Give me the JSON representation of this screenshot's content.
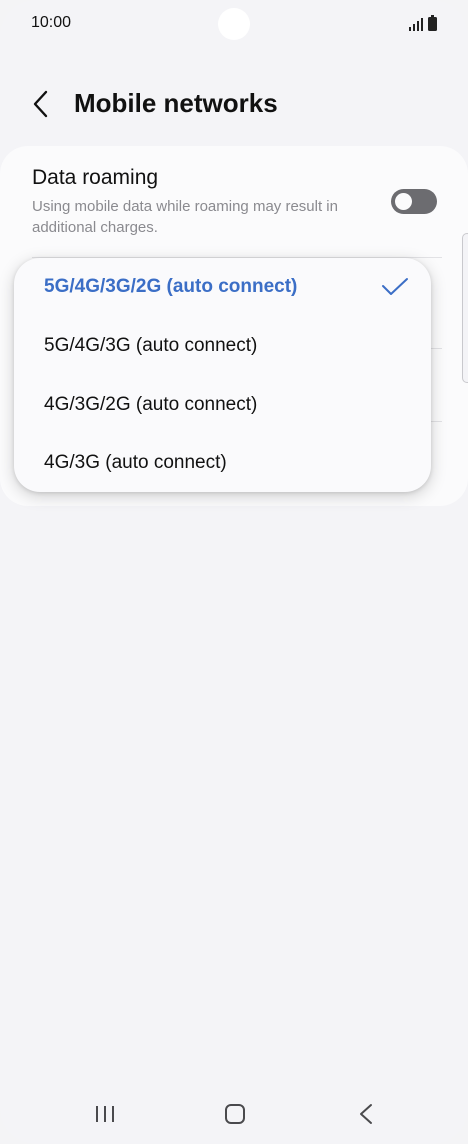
{
  "status_bar": {
    "time": "10:00"
  },
  "header": {
    "title": "Mobile networks"
  },
  "data_roaming": {
    "title": "Data roaming",
    "description": "Using mobile data while roaming may result in additional charges.",
    "enabled": false
  },
  "dropdown": {
    "options": [
      {
        "label": "5G/4G/3G/2G (auto connect)",
        "selected": true
      },
      {
        "label": "5G/4G/3G (auto connect)",
        "selected": false
      },
      {
        "label": "4G/3G/2G (auto connect)",
        "selected": false
      },
      {
        "label": "4G/3G (auto connect)",
        "selected": false
      }
    ]
  },
  "colors": {
    "accent": "#3b6ec6",
    "toggle_off": "#6c6c70",
    "background": "#f4f4f7"
  }
}
